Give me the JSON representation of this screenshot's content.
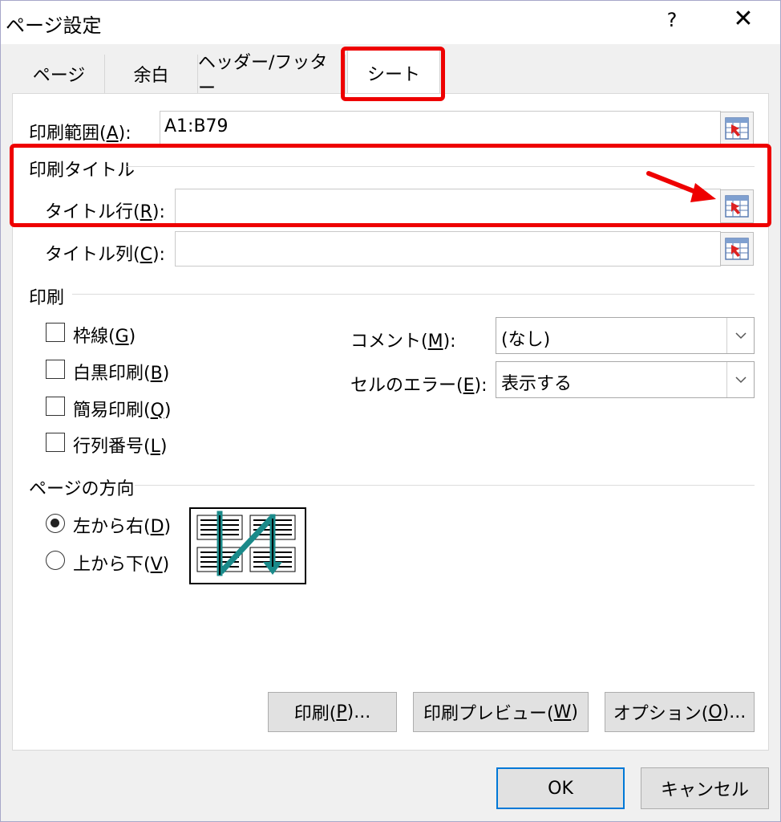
{
  "window": {
    "title": "ページ設定",
    "help_label": "?",
    "close_label": "✕"
  },
  "tabs": [
    {
      "label": "ページ"
    },
    {
      "label": "余白"
    },
    {
      "label": "ヘッダー/フッター"
    },
    {
      "label": "シート",
      "active": true
    }
  ],
  "print_area": {
    "label": "印刷範囲(",
    "key": "A",
    "suffix": "):",
    "value": "A1:B79"
  },
  "print_titles": {
    "section_label": "印刷タイトル",
    "rows": {
      "label": "タイトル行(",
      "key": "R",
      "suffix": "):",
      "value": ""
    },
    "columns": {
      "label": "タイトル列(",
      "key": "C",
      "suffix": "):",
      "value": ""
    }
  },
  "print": {
    "section_label": "印刷",
    "checkboxes": [
      {
        "label": "枠線(",
        "key": "G",
        "suffix": ")",
        "checked": false
      },
      {
        "label": "白黒印刷(",
        "key": "B",
        "suffix": ")",
        "checked": false
      },
      {
        "label": "簡易印刷(",
        "key": "Q",
        "suffix": ")",
        "checked": false
      },
      {
        "label": "行列番号(",
        "key": "L",
        "suffix": ")",
        "checked": false
      }
    ],
    "comments": {
      "label": "コメント(",
      "key": "M",
      "suffix": "):",
      "value": "(なし)"
    },
    "cell_errors": {
      "label": "セルのエラー(",
      "key": "E",
      "suffix": "):",
      "value": "表示する"
    }
  },
  "page_order": {
    "section_label": "ページの方向",
    "options": [
      {
        "label": "左から右(",
        "key": "D",
        "suffix": ")",
        "checked": true
      },
      {
        "label": "上から下(",
        "key": "V",
        "suffix": ")",
        "checked": false
      }
    ]
  },
  "panel_buttons": {
    "print": {
      "label": "印刷(",
      "key": "P",
      "suffix": ")..."
    },
    "preview": {
      "label": "印刷プレビュー(",
      "key": "W",
      "suffix": ")"
    },
    "options": {
      "label": "オプション(",
      "key": "O",
      "suffix": ")..."
    }
  },
  "footer": {
    "ok_label": "OK",
    "cancel_label": "キャンセル"
  },
  "colors": {
    "accent": "#0078d7",
    "highlight": "#ee0000",
    "page_order_arrow": "#1a8a8a"
  },
  "icons": {
    "ref_button": "collapse-dialog-icon",
    "page_order_preview": "page-order-icon"
  }
}
